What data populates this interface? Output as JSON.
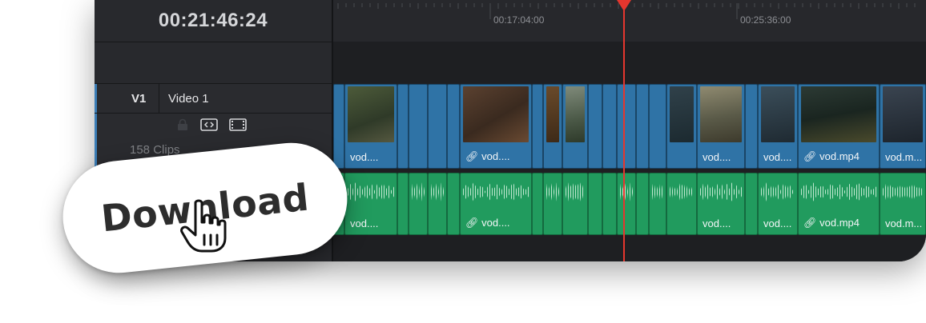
{
  "timecode": "00:21:46:24",
  "ruler": {
    "ticks": [
      "00:17:04:00",
      "00:25:36:00"
    ]
  },
  "track": {
    "id": "V1",
    "name": "Video 1",
    "clip_count": "158 Clips"
  },
  "clips": {
    "short": "vod....",
    "mp4": "vod.mp4",
    "m": "vod.m..."
  },
  "overlay": {
    "download_label": "Download"
  },
  "colors": {
    "video_clip": "#2f73a6",
    "audio_clip": "#219b5e",
    "playhead": "#e5362e",
    "accent": "#3b7db6"
  }
}
